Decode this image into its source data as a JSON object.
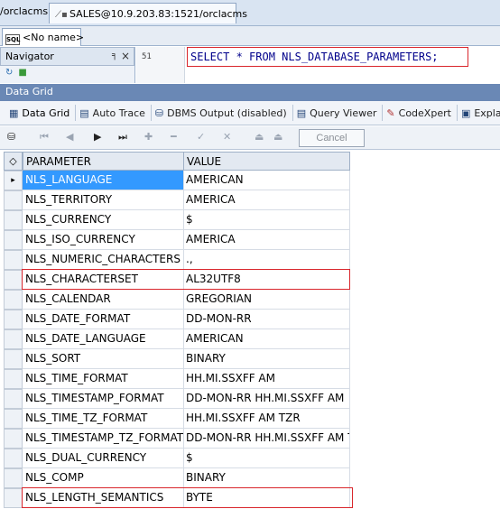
{
  "connection_tabs": {
    "previous_label": "/orclacms",
    "active_label": "SALES@10.9.203.83:1521/orclacms"
  },
  "document_tab": {
    "icon_text": "SQL",
    "label": "<No name>"
  },
  "navigator": {
    "title": "Navigator",
    "pin_icon": "pin-icon",
    "close_icon": "close-icon"
  },
  "editor": {
    "line_number": "51",
    "sql": "SELECT * FROM NLS_DATABASE_PARAMETERS;"
  },
  "grid_title": "Data Grid",
  "result_tabs": [
    "Data Grid",
    "Auto Trace",
    "DBMS Output (disabled)",
    "Query Viewer",
    "CodeXpert",
    "Explain"
  ],
  "toolbar": {
    "cancel_label": "Cancel"
  },
  "table": {
    "columns": [
      "PARAMETER",
      "VALUE"
    ],
    "rows": [
      [
        "NLS_LANGUAGE",
        "AMERICAN"
      ],
      [
        "NLS_TERRITORY",
        "AMERICA"
      ],
      [
        "NLS_CURRENCY",
        "$"
      ],
      [
        "NLS_ISO_CURRENCY",
        "AMERICA"
      ],
      [
        "NLS_NUMERIC_CHARACTERS",
        ".,"
      ],
      [
        "NLS_CHARACTERSET",
        "AL32UTF8"
      ],
      [
        "NLS_CALENDAR",
        "GREGORIAN"
      ],
      [
        "NLS_DATE_FORMAT",
        "DD-MON-RR"
      ],
      [
        "NLS_DATE_LANGUAGE",
        "AMERICAN"
      ],
      [
        "NLS_SORT",
        "BINARY"
      ],
      [
        "NLS_TIME_FORMAT",
        "HH.MI.SSXFF AM"
      ],
      [
        "NLS_TIMESTAMP_FORMAT",
        "DD-MON-RR HH.MI.SSXFF AM"
      ],
      [
        "NLS_TIME_TZ_FORMAT",
        "HH.MI.SSXFF AM TZR"
      ],
      [
        "NLS_TIMESTAMP_TZ_FORMAT",
        "DD-MON-RR HH.MI.SSXFF AM TZR"
      ],
      [
        "NLS_DUAL_CURRENCY",
        "$"
      ],
      [
        "NLS_COMP",
        "BINARY"
      ],
      [
        "NLS_LENGTH_SEMANTICS",
        "BYTE"
      ]
    ],
    "selected_row": 0,
    "highlighted_rows": [
      5,
      16
    ]
  },
  "colors": {
    "highlight": "#d9262c",
    "selection": "#3399ff",
    "grid_title_bg": "#6a88b5"
  }
}
